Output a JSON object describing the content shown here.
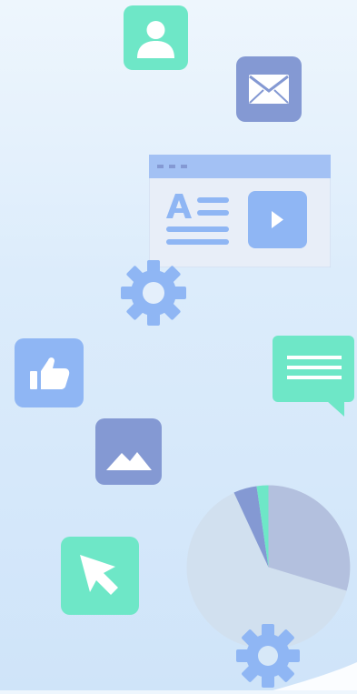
{
  "colors": {
    "mint": "#6ee7c7",
    "periwinkle": "#8499d3",
    "sky": "#8fb6f4",
    "pale_panel": "#e8eef8",
    "panel_bar": "#a3c1f4",
    "pie_light": "#d1e0ef",
    "pie_slate": "#b3c0de",
    "pie_blue": "#8499d3",
    "pie_mint": "#6ee7c7"
  },
  "icons": [
    {
      "name": "user-profile-icon",
      "color": "mint"
    },
    {
      "name": "mail-envelope-icon",
      "color": "periwinkle"
    },
    {
      "name": "content-window-icon",
      "color": "pale_panel"
    },
    {
      "name": "gear-icon",
      "color": "sky"
    },
    {
      "name": "thumbs-up-icon",
      "color": "sky"
    },
    {
      "name": "chat-message-icon",
      "color": "mint"
    },
    {
      "name": "image-mountain-icon",
      "color": "periwinkle"
    },
    {
      "name": "cursor-pointer-icon",
      "color": "mint"
    },
    {
      "name": "pie-chart-icon",
      "color": "pie_light"
    },
    {
      "name": "gear-icon",
      "color": "sky"
    }
  ]
}
